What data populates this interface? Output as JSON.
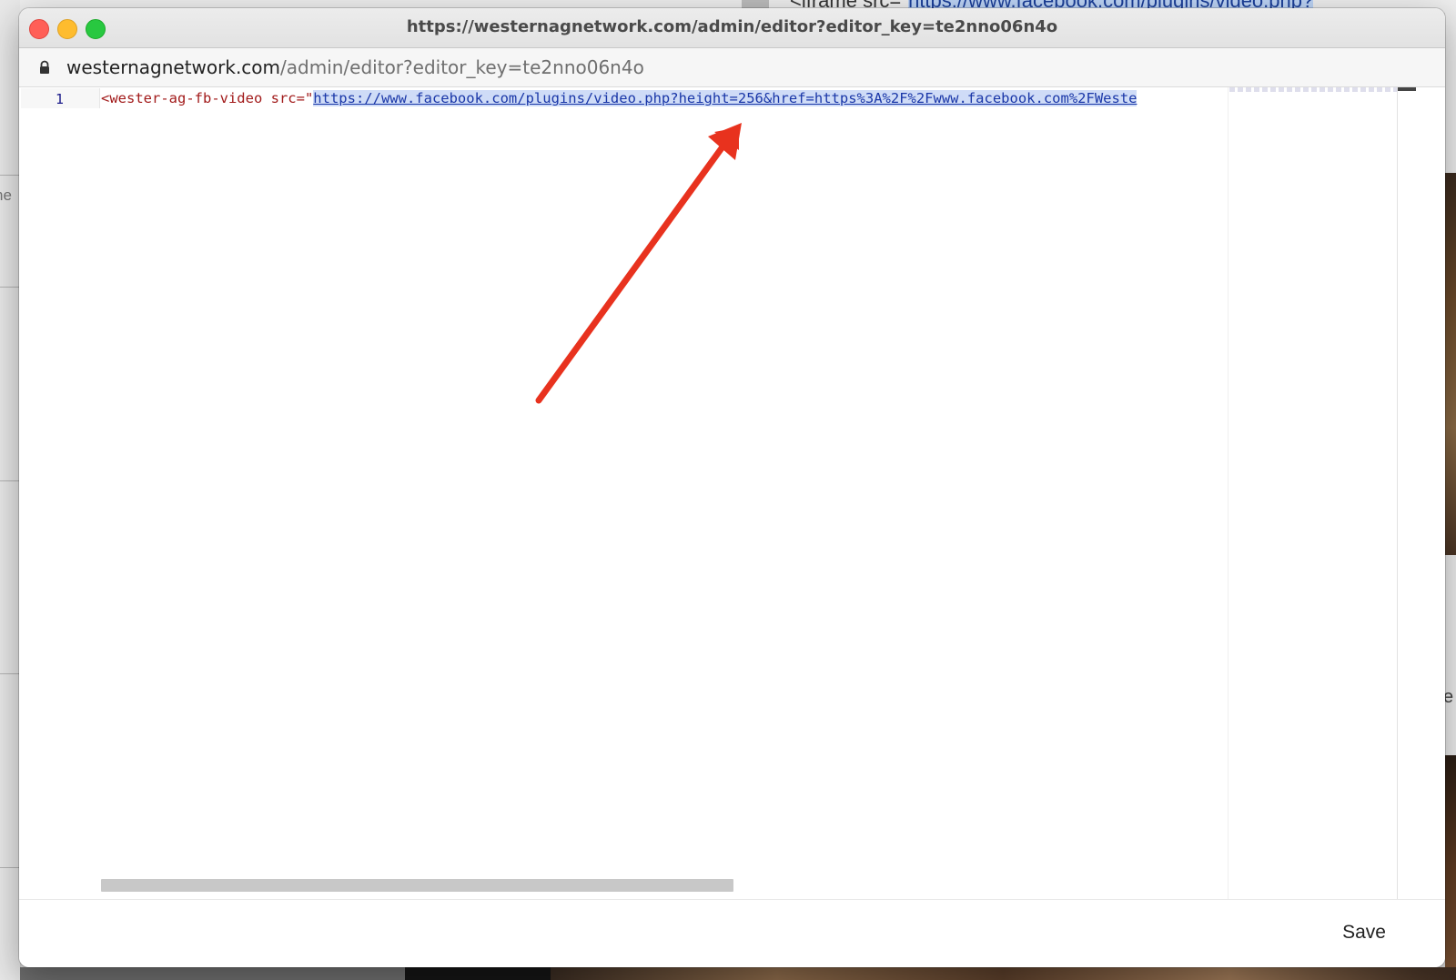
{
  "window": {
    "title": "https://westernagnetwork.com/admin/editor?editor_key=te2nno06n4o"
  },
  "address_bar": {
    "domain": "westernagnetwork.com",
    "path": "/admin/editor?editor_key=te2nno06n4o",
    "icon": "lock-icon"
  },
  "editor": {
    "line_number": "1",
    "tag_open": "<wester-ag-fb-video src=\"",
    "url_value": "https://www.facebook.com/plugins/video.php?height=256&href=https%3A%2F%2Fwww.facebook.com%2FWeste"
  },
  "footer": {
    "save_label": "Save"
  },
  "background": {
    "left_text": "ne",
    "right_char": "e",
    "top_code_prefix": "<iframe src=\"",
    "top_code_url": "https://www.facebook.com/plugins/video.php?"
  },
  "colors": {
    "arrow": "#e8321e",
    "selection": "#cfdcf7",
    "link": "#1a37a8",
    "tag": "#a21b1b"
  }
}
